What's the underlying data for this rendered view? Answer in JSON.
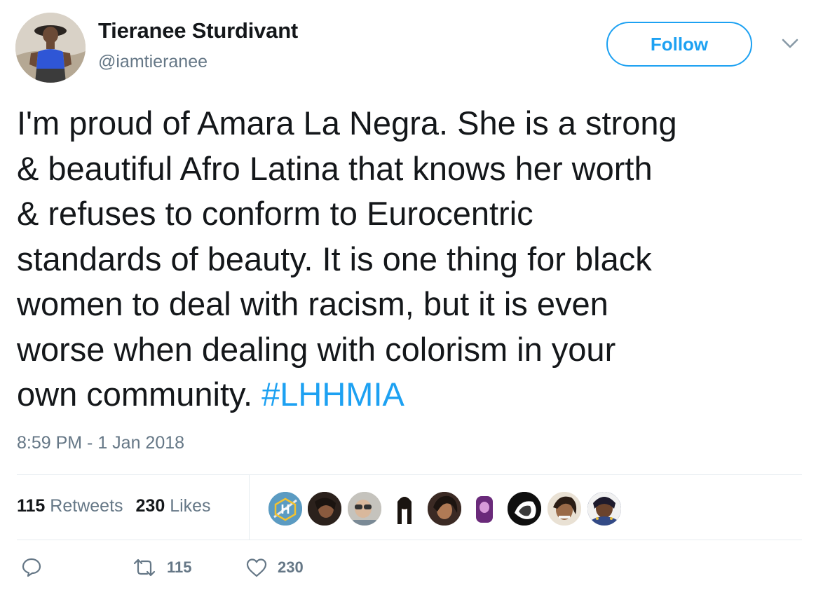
{
  "author": {
    "name": "Tieranee Sturdivant",
    "handle": "@iamtieranee"
  },
  "follow_label": "Follow",
  "tweet": {
    "lines": [
      "I'm proud of Amara La Negra. She is a strong",
      "& beautiful Afro Latina that knows her worth",
      "& refuses to conform to Eurocentric",
      "standards of beauty. It is one thing for black",
      "women to deal with racism, but it is even",
      "worse when dealing with colorism in your"
    ],
    "last_line": "own community.",
    "hashtag": "#LHHMIA"
  },
  "timestamp": "8:59 PM - 1 Jan 2018",
  "stats": {
    "retweets_count": "115",
    "retweets_label": "Retweets",
    "likes_count": "230",
    "likes_label": "Likes"
  },
  "liker_avatar_count": 9,
  "actions": {
    "reply_icon": "reply-icon",
    "retweet_icon": "retweet-icon",
    "retweet_count": "115",
    "like_icon": "heart-icon",
    "like_count": "230"
  },
  "colors": {
    "accent": "#1da1f2",
    "text": "#14171a",
    "secondary": "#657786",
    "divider": "#e6ecf0"
  }
}
